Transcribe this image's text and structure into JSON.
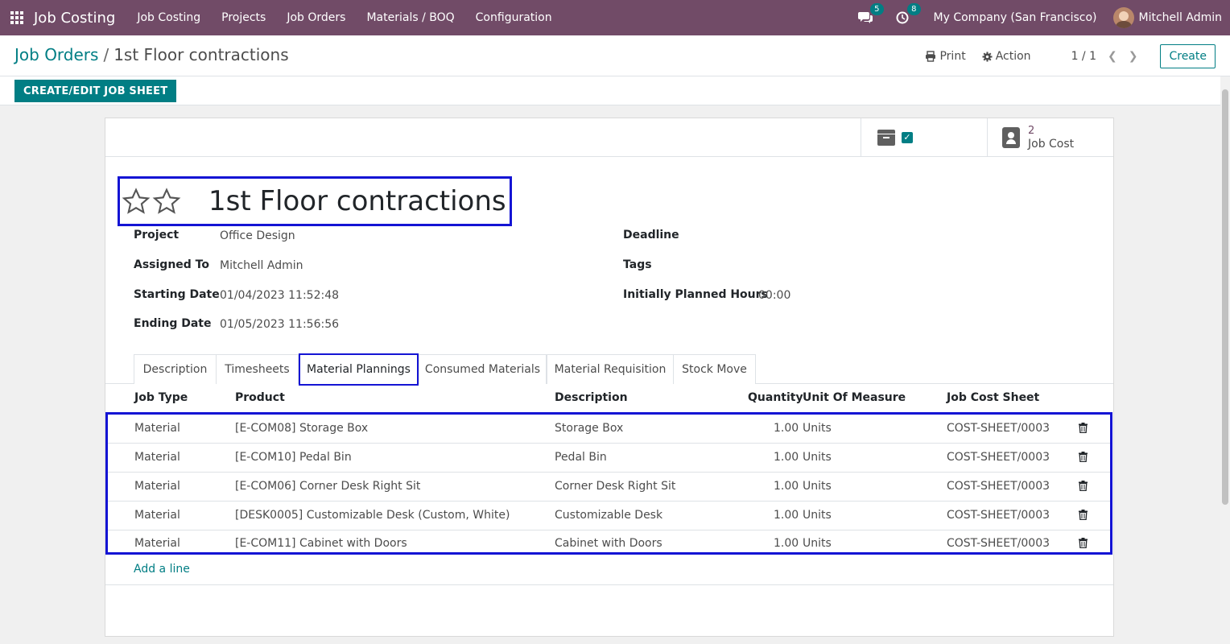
{
  "navbar": {
    "app_name": "Job Costing",
    "menu": [
      "Job Costing",
      "Projects",
      "Job Orders",
      "Materials / BOQ",
      "Configuration"
    ],
    "messages_count": "5",
    "activities_count": "8",
    "company": "My Company (San Francisco)",
    "user": "Mitchell Admin"
  },
  "control": {
    "breadcrumb_parent": "Job Orders",
    "breadcrumb_sep": "/",
    "breadcrumb_current": "1st Floor contractions",
    "print_label": "Print",
    "action_label": "Action",
    "pager": "1 / 1",
    "create_label": "Create"
  },
  "statusbar": {
    "jobsheet_label": "CREATE/EDIT JOB SHEET"
  },
  "smart_buttons": {
    "job_cost_count": "2",
    "job_cost_label": "Job Cost"
  },
  "record": {
    "title": "1st Floor contractions",
    "fields_left": [
      {
        "label": "Project",
        "value": "Office Design"
      },
      {
        "label": "Assigned To",
        "value": "Mitchell Admin"
      },
      {
        "label": "Starting Date",
        "value": "01/04/2023 11:52:48"
      },
      {
        "label": "Ending Date",
        "value": "01/05/2023 11:56:56"
      }
    ],
    "fields_right": [
      {
        "label": "Deadline",
        "value": ""
      },
      {
        "label": "Tags",
        "value": ""
      },
      {
        "label": "Initially Planned Hours",
        "value": "00:00"
      }
    ]
  },
  "tabs": [
    "Description",
    "Timesheets",
    "Material Plannings",
    "Consumed Materials",
    "Material Requisition",
    "Stock Move"
  ],
  "table": {
    "headers": [
      "Job Type",
      "Product",
      "Description",
      "Quantity",
      "Unit Of Measure",
      "Job Cost Sheet"
    ],
    "rows": [
      {
        "job_type": "Material",
        "product": "[E-COM08] Storage Box",
        "description": "Storage Box",
        "quantity": "1.00",
        "uom": "Units",
        "sheet": "COST-SHEET/0003"
      },
      {
        "job_type": "Material",
        "product": "[E-COM10] Pedal Bin",
        "description": "Pedal Bin",
        "quantity": "1.00",
        "uom": "Units",
        "sheet": "COST-SHEET/0003"
      },
      {
        "job_type": "Material",
        "product": "[E-COM06] Corner Desk Right Sit",
        "description": "Corner Desk Right Sit",
        "quantity": "1.00",
        "uom": "Units",
        "sheet": "COST-SHEET/0003"
      },
      {
        "job_type": "Material",
        "product": "[DESK0005] Customizable Desk (Custom, White)",
        "description": "Customizable Desk",
        "quantity": "1.00",
        "uom": "Units",
        "sheet": "COST-SHEET/0003"
      },
      {
        "job_type": "Material",
        "product": "[E-COM11] Cabinet with Doors",
        "description": "Cabinet with Doors",
        "quantity": "1.00",
        "uom": "Units",
        "sheet": "COST-SHEET/0003"
      }
    ],
    "add_line": "Add a line"
  },
  "colors": {
    "navbar": "#714b67",
    "accent": "#017e84",
    "highlight_box": "#1414d4"
  }
}
